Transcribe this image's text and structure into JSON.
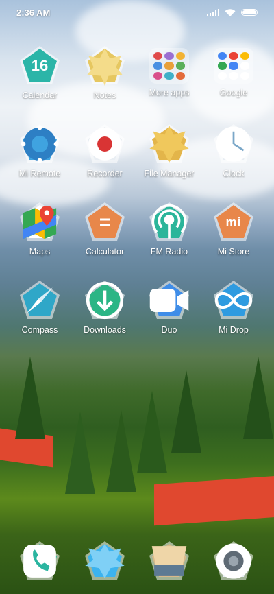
{
  "status_bar": {
    "time": "2:36 AM"
  },
  "apps": [
    {
      "label": "Calendar",
      "icon": "calendar-icon",
      "color": "#2bb5a8",
      "glyph": "16"
    },
    {
      "label": "Notes",
      "icon": "notes-leaf-icon",
      "color": "#e6c760",
      "glyph": ""
    },
    {
      "label": "More apps",
      "icon": "folder-icon",
      "color": "",
      "glyph": ""
    },
    {
      "label": "Google",
      "icon": "google-folder-icon",
      "color": "",
      "glyph": ""
    },
    {
      "label": "Mi Remote",
      "icon": "remote-icon",
      "color": "#3fa3e0",
      "glyph": ""
    },
    {
      "label": "Recorder",
      "icon": "recorder-icon",
      "color": "#e9eef3",
      "glyph": ""
    },
    {
      "label": "File Manager",
      "icon": "file-manager-icon",
      "color": "#e3b54a",
      "glyph": ""
    },
    {
      "label": "Clock",
      "icon": "clock-icon",
      "color": "#e9eef3",
      "glyph": ""
    },
    {
      "label": "Maps",
      "icon": "maps-icon",
      "color": "#ffffff",
      "glyph": ""
    },
    {
      "label": "Calculator",
      "icon": "calculator-icon",
      "color": "#e8874a",
      "glyph": "="
    },
    {
      "label": "FM Radio",
      "icon": "radio-icon",
      "color": "#2bb59a",
      "glyph": ""
    },
    {
      "label": "Mi Store",
      "icon": "mi-store-icon",
      "color": "#e8874a",
      "glyph": "mi"
    },
    {
      "label": "Compass",
      "icon": "compass-icon",
      "color": "#2fa7c8",
      "glyph": ""
    },
    {
      "label": "Downloads",
      "icon": "download-icon",
      "color": "#2bb585",
      "glyph": ""
    },
    {
      "label": "Duo",
      "icon": "video-call-icon",
      "color": "#3f8de8",
      "glyph": ""
    },
    {
      "label": "Mi Drop",
      "icon": "mi-drop-icon",
      "color": "#2f9be0",
      "glyph": ""
    }
  ],
  "dock": [
    {
      "label": "",
      "icon": "phone-icon",
      "color": "#2bb5a0"
    },
    {
      "label": "",
      "icon": "messages-leaf-icon",
      "color": "#3cb3ee"
    },
    {
      "label": "",
      "icon": "browser-icon",
      "color": "#d9b98a"
    },
    {
      "label": "",
      "icon": "camera-icon",
      "color": "#e9eef3"
    }
  ]
}
